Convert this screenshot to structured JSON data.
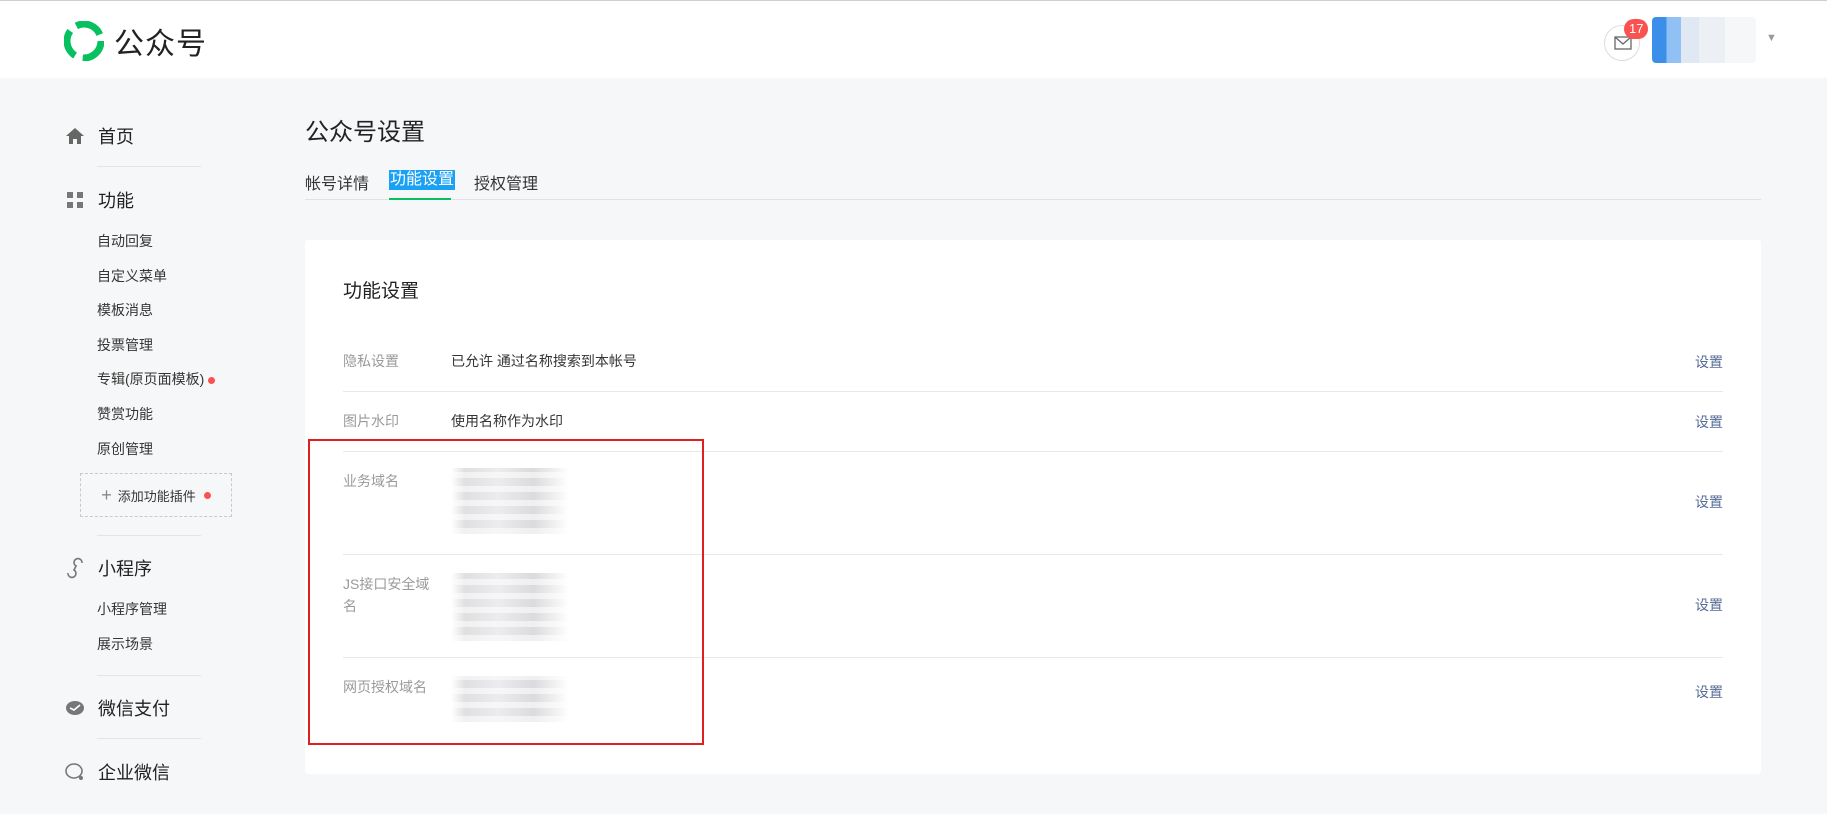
{
  "header": {
    "brand": "公众号",
    "message_badge": "17",
    "brand_color": "#07c160"
  },
  "sidebar": {
    "home": "首页",
    "features": "功能",
    "feature_items": [
      "自动回复",
      "自定义菜单",
      "模板消息",
      "投票管理",
      "专辑(原页面模板)",
      "赞赏功能",
      "原创管理"
    ],
    "add_plugin": "添加功能插件",
    "miniprogram": "小程序",
    "miniprogram_items": [
      "小程序管理",
      "展示场景"
    ],
    "wechat_pay": "微信支付",
    "wecom": "企业微信"
  },
  "page": {
    "title": "公众号设置",
    "tabs": [
      "帐号详情",
      "功能设置",
      "授权管理"
    ],
    "active_tab": "功能设置"
  },
  "card": {
    "title": "功能设置",
    "rows": [
      {
        "label": "隐私设置",
        "value": "已允许 通过名称搜索到本帐号",
        "action": "设置"
      },
      {
        "label": "图片水印",
        "value": "使用名称作为水印",
        "action": "设置"
      },
      {
        "label": "业务域名",
        "value": "",
        "action": "设置"
      },
      {
        "label": "JS接口安全域名",
        "value": "",
        "action": "设置"
      },
      {
        "label": "网页授权域名",
        "value": "",
        "action": "设置"
      }
    ]
  }
}
